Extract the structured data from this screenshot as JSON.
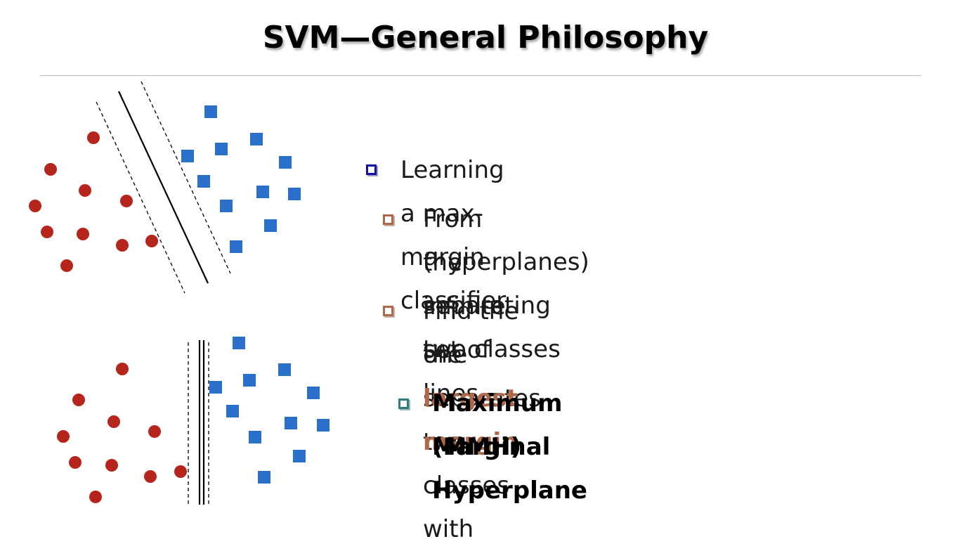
{
  "title": "SVM—General Philosophy",
  "bullets": {
    "b1": "Learning a max-margin classifier",
    "b2_line1": "From the infinite set of lines",
    "b2_line2": "(hyperplanes) separating two classes",
    "b3_line1": "Find the one separates two classes with",
    "b3_line2_prefix": "the ",
    "b3_line2_highlight": "largest margin",
    "b4_line1": "Maximum Marginal Hyperplane",
    "b4_line2": "(MMH)"
  },
  "colors": {
    "class_red": "#b5251c",
    "class_blue": "#2a6fc9",
    "bullet_blue": "#1010a8",
    "bullet_brown": "#b0684a",
    "bullet_teal": "#2e7d7d",
    "highlight": "#b0684a"
  },
  "icons": {
    "top_level_bullet": "square-outline-icon",
    "sub_bullet": "square-outline-icon"
  }
}
